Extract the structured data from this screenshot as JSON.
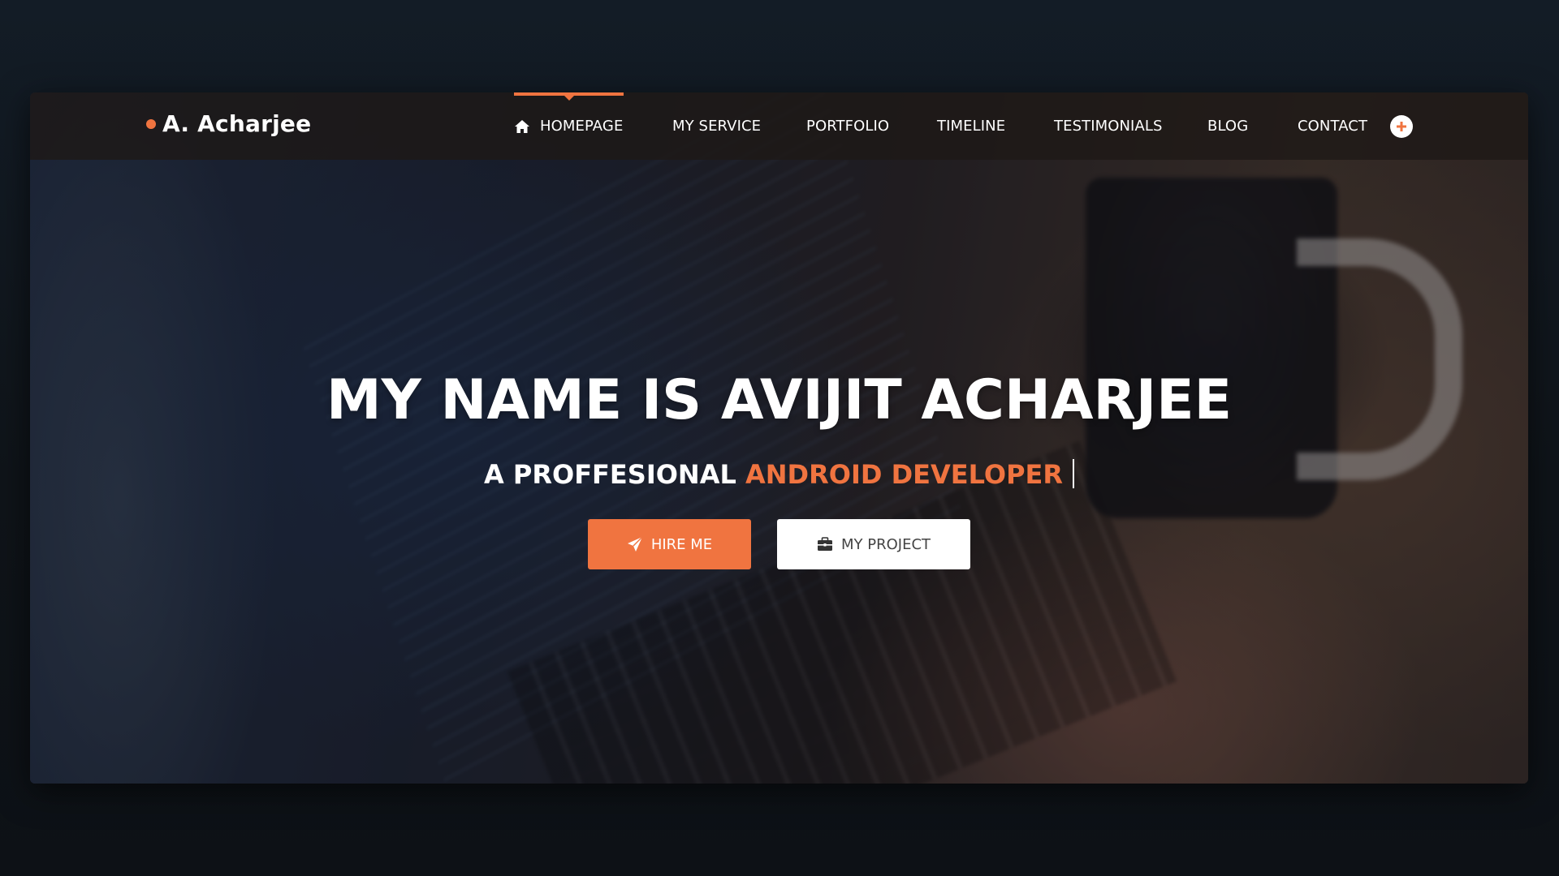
{
  "brand": {
    "name": "A. Acharjee",
    "accent_color": "#f07440"
  },
  "nav": {
    "items": [
      {
        "label": "HOMEPAGE",
        "icon": "home-icon",
        "active": true
      },
      {
        "label": "MY SERVICE"
      },
      {
        "label": "PORTFOLIO"
      },
      {
        "label": "TIMELINE"
      },
      {
        "label": "TESTIMONIALS"
      },
      {
        "label": "BLOG"
      },
      {
        "label": "CONTACT"
      }
    ],
    "extra_icon": "plus-circle-icon"
  },
  "hero": {
    "title": "MY NAME IS AVIJIT ACHARJEE",
    "subtitle_prefix": "A PROFFESIONAL",
    "subtitle_highlight": "ANDROID DEVELOPER",
    "buttons": {
      "hire": {
        "label": "HIRE ME",
        "icon": "rocket-icon"
      },
      "project": {
        "label": "MY PROJECT",
        "icon": "briefcase-icon"
      }
    }
  },
  "colors": {
    "accent": "#f07440",
    "text_light": "#ffffff",
    "page_background": "#101820"
  }
}
